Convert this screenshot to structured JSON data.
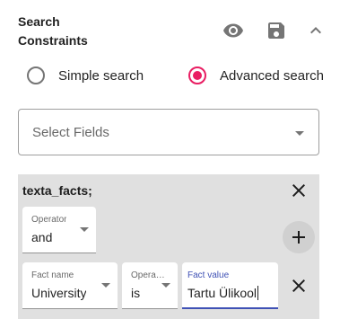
{
  "header": {
    "title": "Search Constraints",
    "icons": [
      "eye-icon",
      "save-icon",
      "chevron-up-icon"
    ]
  },
  "search_mode": {
    "options": [
      {
        "label": "Simple search",
        "selected": false
      },
      {
        "label": "Advanced search",
        "selected": true
      }
    ],
    "accent": "#e91e63"
  },
  "select_fields": {
    "placeholder": "Select Fields"
  },
  "constraint": {
    "title": "texta_facts;",
    "operator": {
      "label": "Operator",
      "value": "and"
    },
    "fact_name": {
      "label": "Fact name",
      "value": "University"
    },
    "fact_operator": {
      "label": "Opera…",
      "value": "is"
    },
    "fact_value": {
      "label": "Fact value",
      "value": "Tartu Ülikool"
    },
    "focus_color": "#3f51b5",
    "background": "#e0e0e0"
  }
}
